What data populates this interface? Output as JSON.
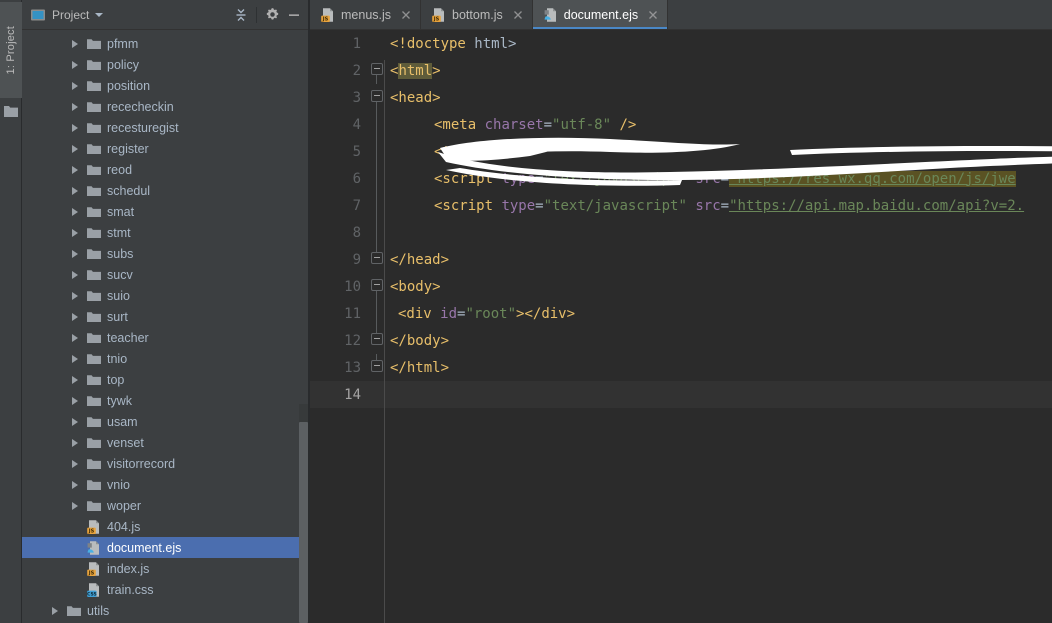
{
  "window": {
    "theme_bg": "#3c3f41",
    "editor_bg": "#2b2b2b",
    "accent": "#4a88c7",
    "selection": "#4b6eaf"
  },
  "tool_strip": {
    "tab_prefix": "1",
    "tab_label": "1: Project"
  },
  "project_panel": {
    "title": "Project",
    "icons": {
      "project": "project-icon",
      "caret": "chevron-down-icon",
      "collapse_all": "collapse-all-icon",
      "settings": "gear-icon",
      "hide": "minimize-icon"
    },
    "tree": [
      {
        "label": "pfmm",
        "type": "folder",
        "indent": 1,
        "expandable": true,
        "selected": false
      },
      {
        "label": "policy",
        "type": "folder",
        "indent": 1,
        "expandable": true,
        "selected": false
      },
      {
        "label": "position",
        "type": "folder",
        "indent": 1,
        "expandable": true,
        "selected": false
      },
      {
        "label": "rececheckin",
        "type": "folder",
        "indent": 1,
        "expandable": true,
        "selected": false
      },
      {
        "label": "recesturegist",
        "type": "folder",
        "indent": 1,
        "expandable": true,
        "selected": false
      },
      {
        "label": "register",
        "type": "folder",
        "indent": 1,
        "expandable": true,
        "selected": false
      },
      {
        "label": "reod",
        "type": "folder",
        "indent": 1,
        "expandable": true,
        "selected": false
      },
      {
        "label": "schedul",
        "type": "folder",
        "indent": 1,
        "expandable": true,
        "selected": false
      },
      {
        "label": "smat",
        "type": "folder",
        "indent": 1,
        "expandable": true,
        "selected": false
      },
      {
        "label": "stmt",
        "type": "folder",
        "indent": 1,
        "expandable": true,
        "selected": false
      },
      {
        "label": "subs",
        "type": "folder",
        "indent": 1,
        "expandable": true,
        "selected": false
      },
      {
        "label": "sucv",
        "type": "folder",
        "indent": 1,
        "expandable": true,
        "selected": false
      },
      {
        "label": "suio",
        "type": "folder",
        "indent": 1,
        "expandable": true,
        "selected": false
      },
      {
        "label": "surt",
        "type": "folder",
        "indent": 1,
        "expandable": true,
        "selected": false
      },
      {
        "label": "teacher",
        "type": "folder",
        "indent": 1,
        "expandable": true,
        "selected": false
      },
      {
        "label": "tnio",
        "type": "folder",
        "indent": 1,
        "expandable": true,
        "selected": false
      },
      {
        "label": "top",
        "type": "folder",
        "indent": 1,
        "expandable": true,
        "selected": false
      },
      {
        "label": "tywk",
        "type": "folder",
        "indent": 1,
        "expandable": true,
        "selected": false
      },
      {
        "label": "usam",
        "type": "folder",
        "indent": 1,
        "expandable": true,
        "selected": false
      },
      {
        "label": "venset",
        "type": "folder",
        "indent": 1,
        "expandable": true,
        "selected": false
      },
      {
        "label": "visitorrecord",
        "type": "folder",
        "indent": 1,
        "expandable": true,
        "selected": false
      },
      {
        "label": "vnio",
        "type": "folder",
        "indent": 1,
        "expandable": true,
        "selected": false
      },
      {
        "label": "woper",
        "type": "folder",
        "indent": 1,
        "expandable": true,
        "selected": false
      },
      {
        "label": "404.js",
        "type": "js",
        "indent": 1,
        "expandable": false,
        "selected": false
      },
      {
        "label": "document.ejs",
        "type": "ejs",
        "indent": 1,
        "expandable": false,
        "selected": true
      },
      {
        "label": "index.js",
        "type": "js",
        "indent": 1,
        "expandable": false,
        "selected": false
      },
      {
        "label": "train.css",
        "type": "css",
        "indent": 1,
        "expandable": false,
        "selected": false
      },
      {
        "label": "utils",
        "type": "folder",
        "indent": 0,
        "expandable": true,
        "selected": false
      }
    ]
  },
  "tabs": [
    {
      "label": "menus.js",
      "icon": "js-file-icon",
      "active": false
    },
    {
      "label": "bottom.js",
      "icon": "js-file-icon",
      "active": false
    },
    {
      "label": "document.ejs",
      "icon": "ejs-file-icon",
      "active": true
    }
  ],
  "editor": {
    "language": "html",
    "current_line": 14,
    "lines": [
      {
        "n": "1",
        "fold": "none",
        "text": "<!doctype html>"
      },
      {
        "n": "2",
        "fold": "down",
        "text": "<html>"
      },
      {
        "n": "3",
        "fold": "down",
        "text": "<head>"
      },
      {
        "n": "4",
        "fold": "none",
        "text": "    <meta charset=\"utf-8\" />"
      },
      {
        "n": "5",
        "fold": "none",
        "text": "    <title>"
      },
      {
        "n": "6",
        "fold": "none",
        "text": "    <script type=\"text/javascript\" src=\"https://res.wx.qq.com/open/js/jwe"
      },
      {
        "n": "7",
        "fold": "none",
        "text": "    <script type=\"text/javascript\" src=\"https://api.map.baidu.com/api?v=2."
      },
      {
        "n": "8",
        "fold": "none",
        "text": ""
      },
      {
        "n": "9",
        "fold": "up",
        "text": "</head>"
      },
      {
        "n": "10",
        "fold": "down",
        "text": "<body>"
      },
      {
        "n": "11",
        "fold": "none",
        "text": " <div id=\"root\"></div>"
      },
      {
        "n": "12",
        "fold": "up",
        "text": "</body>"
      },
      {
        "n": "13",
        "fold": "up",
        "text": "</html>"
      },
      {
        "n": "14",
        "fold": "none",
        "text": ""
      }
    ],
    "tokens": {
      "l1_doctype": "<!doctype",
      "l1_html": " html>",
      "l2_open": "<",
      "l2_name": "html",
      "l2_close": ">",
      "l3": "<head>",
      "l4_tag": "<meta",
      "l4_attr": " charset",
      "l4_eq": "=",
      "l4_val": "\"utf-8\"",
      "l4_end": " />",
      "l5_title": "<title>",
      "l6_tag": "<script",
      "l6_attr1": " type",
      "l6_val1": "\"text/javascript\"",
      "l6_attr2": " src",
      "l6_url": "\"https://res.wx.qq.com/open/js/jwe",
      "l7_tag": "<script",
      "l7_attr1": " type",
      "l7_val1": "\"text/javascript\"",
      "l7_attr2": " src",
      "l7_url": "\"https://api.map.baidu.com/api?v=2.",
      "l9": "</head>",
      "l10": "<body>",
      "l11_open": "<div ",
      "l11_attr": "id",
      "l11_val": "\"root\"",
      "l11_gt": ">",
      "l11_close": "</div>",
      "l12": "</body>",
      "l13": "</html>"
    }
  }
}
